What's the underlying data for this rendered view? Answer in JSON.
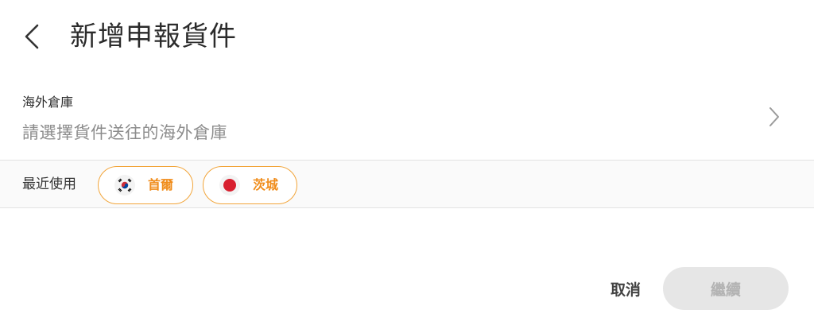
{
  "header": {
    "title": "新增申報貨件",
    "back_icon": "chevron-left-icon"
  },
  "warehouse": {
    "label": "海外倉庫",
    "placeholder": "請選擇貨件送往的海外倉庫",
    "chevron_icon": "chevron-right-icon"
  },
  "recent": {
    "label": "最近使用",
    "items": [
      {
        "label": "首爾",
        "flag": "south-korea-flag-icon"
      },
      {
        "label": "茨城",
        "flag": "japan-flag-icon"
      }
    ]
  },
  "actions": {
    "cancel_label": "取消",
    "continue_label": "繼續"
  },
  "colors": {
    "accent": "#f08c1a",
    "chip_border": "#f2a53a",
    "disabled_bg": "#e6e6e6",
    "disabled_text": "#b3b3b3"
  }
}
